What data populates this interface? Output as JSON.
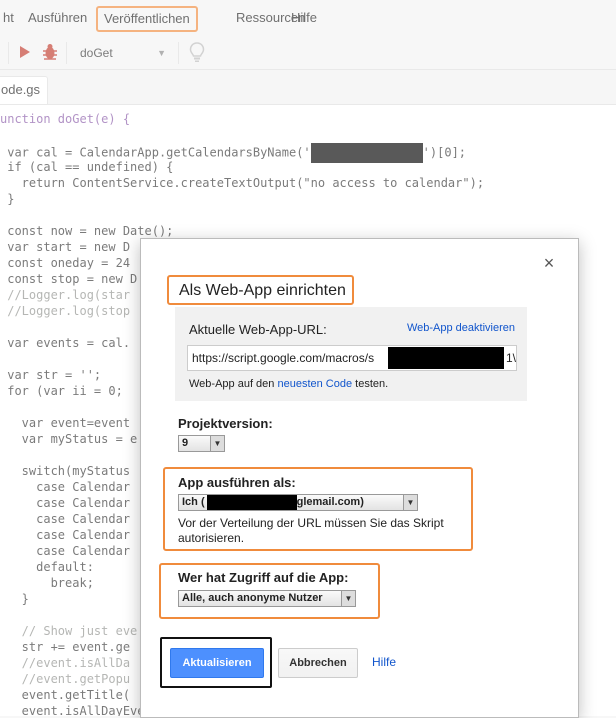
{
  "menu": {
    "items": [
      "ht",
      "Ausführen",
      "Veröffentlichen",
      "Ressourcen",
      "Hilfe"
    ]
  },
  "toolbar": {
    "function_select": "doGet"
  },
  "file_tab": {
    "label": "ode.gs"
  },
  "code": {
    "l1": "unction doGet(e) {",
    "l2a": " var cal = CalendarApp.getCalendarsByName('",
    "l2b": "')[0];",
    "l3": " if (cal == undefined) {",
    "l4": "   return ContentService.createTextOutput(\"no access to calendar\");",
    "l5": " }",
    "l6": " const now = new Date();",
    "l7": " var start = new D",
    "l8": " const oneday = 24",
    "l9": " const stop = new D",
    "l10": " //Logger.log(star",
    "l11": " //Logger.log(stop",
    "l12": " var events = cal.",
    "l13": " var str = '';",
    "l14": " for (var ii = 0;",
    "l15": "   var event=event",
    "l16": "   var myStatus = e",
    "l17": "   switch(myStatus",
    "l18": "     case Calendar",
    "l19": "     case Calendar",
    "l20": "     case Calendar",
    "l21": "     case Calendar",
    "l22": "     case Calendar",
    "l23": "     default:",
    "l24": "       break;",
    "l25": "   }",
    "l26": "   // Show just eve",
    "l27": "   str += event.ge",
    "l28": "   //event.isAllDa",
    "l29": "   //event.getPopu",
    "l30": "   event.getTitle(",
    "l31": "   event.isAllDayEvent() + ':';"
  },
  "dialog": {
    "title": "Als Web-App einrichten",
    "close_label": "×",
    "url_label": "Aktuelle Web-App-URL:",
    "deactivate_link": "Web-App deaktivieren",
    "url_value": "https://script.google.com/macros/s",
    "url_tail": "1\\",
    "test_prefix": "Web-App auf den ",
    "test_link": "neuesten Code",
    "test_suffix": " testen.",
    "project_version_label": "Projektversion:",
    "project_version_value": "9",
    "run_as_label": "App ausführen als:",
    "run_as_prefix": "Ich (",
    "run_as_suffix": "glemail.com)",
    "run_as_note": "Vor der Verteilung der URL müssen Sie das Skript autorisieren.",
    "access_label": "Wer hat Zugriff auf die App:",
    "access_value": "Alle, auch anonyme Nutzer",
    "update_button": "Aktualisieren",
    "cancel_button": "Abbrechen",
    "help_link": "Hilfe"
  },
  "colors": {
    "highlight": "#f08b3c",
    "primary_button": "#4d90fe",
    "link": "#1155cc"
  }
}
